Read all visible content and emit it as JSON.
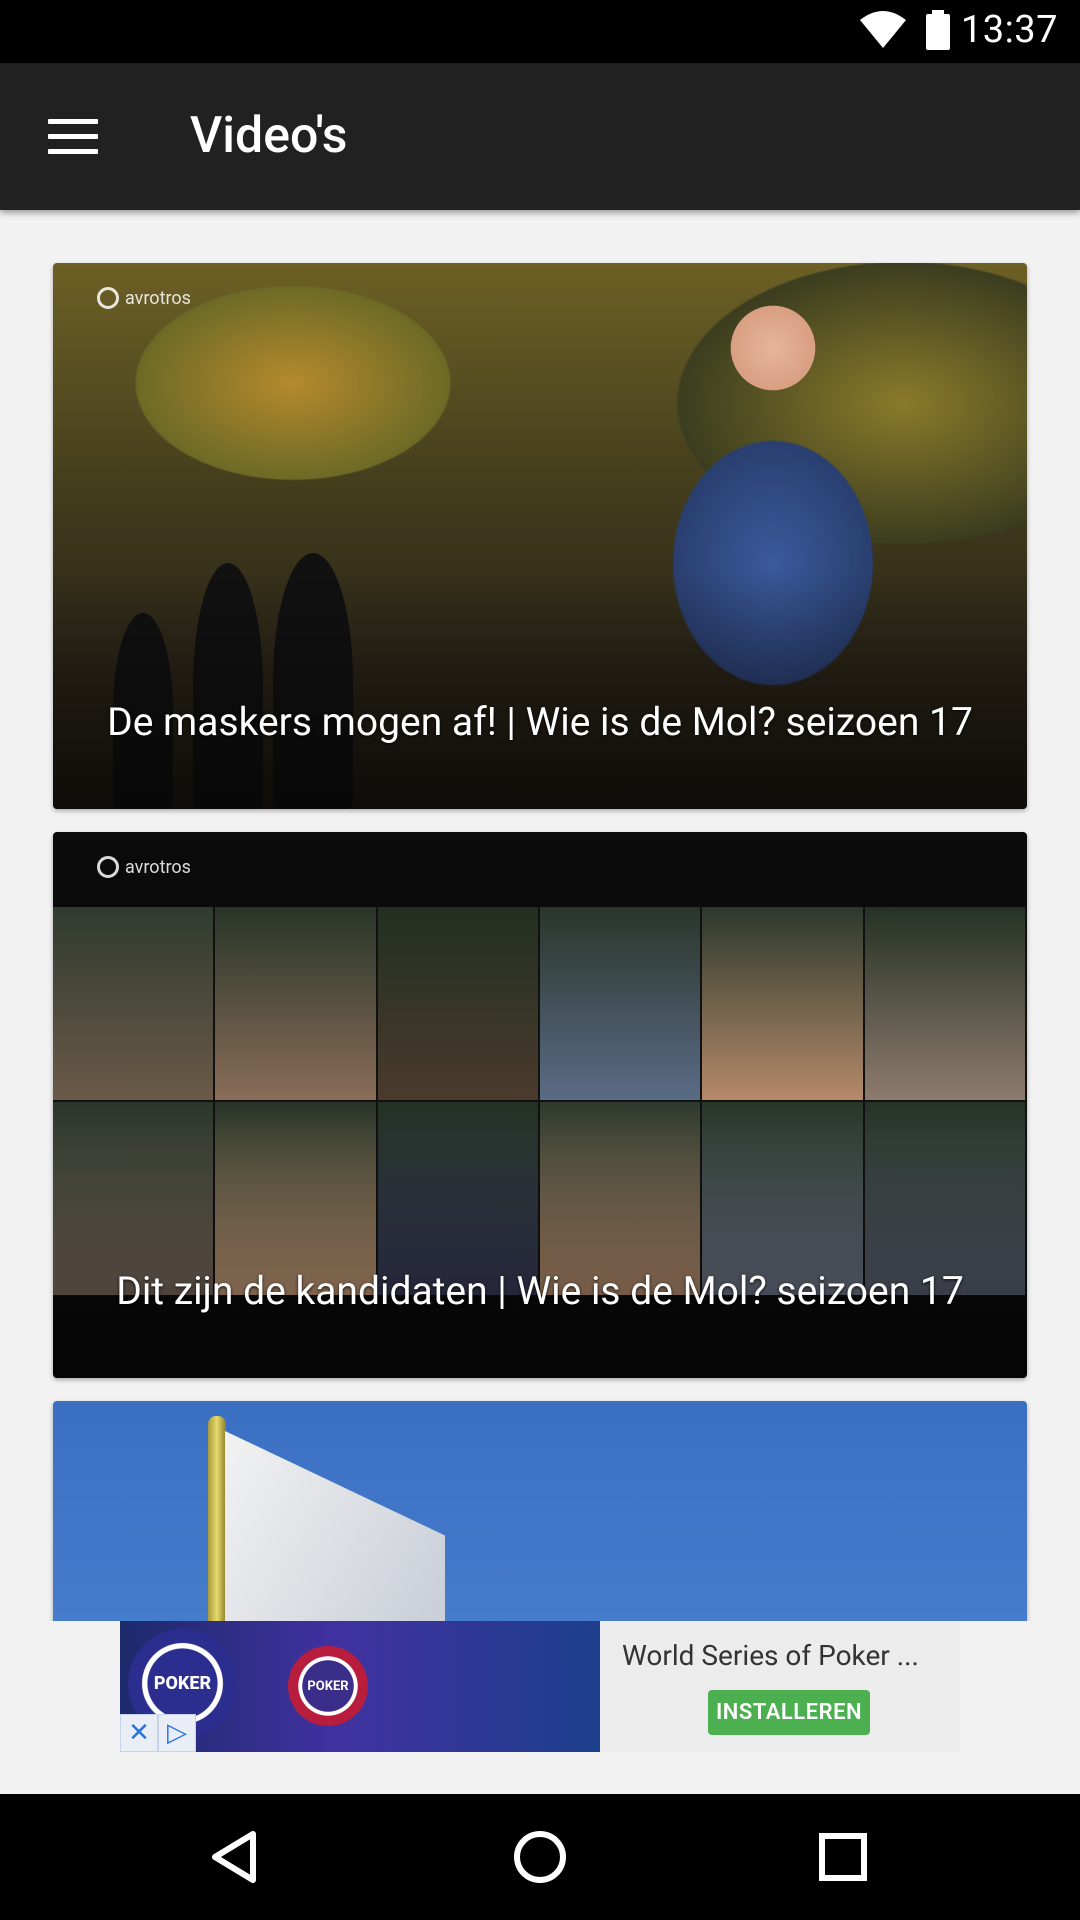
{
  "status_bar": {
    "time": "13:37",
    "icons": [
      "wifi-icon",
      "battery-icon"
    ]
  },
  "app_bar": {
    "title": "Video's",
    "menu_icon": "menu-icon"
  },
  "videos": [
    {
      "title": "De maskers mogen af! | Wie is de Mol? seizoen 17",
      "watermark": "avrotros"
    },
    {
      "title": "Dit zijn de kandidaten | Wie is de Mol? seizoen 17",
      "watermark": "avrotros"
    },
    {
      "title": ""
    }
  ],
  "ad": {
    "title": "World Series of Poker ...",
    "install_label": "INSTALLEREN",
    "chip_text": "POKER",
    "close_glyph": "✕",
    "adchoices_glyph": "▷"
  },
  "nav_bar": {
    "buttons": [
      "back-icon",
      "home-icon",
      "recents-icon"
    ]
  },
  "colors": {
    "app_bar": "#212121",
    "install_green": "#4caf50",
    "background": "#f2f2f2"
  }
}
